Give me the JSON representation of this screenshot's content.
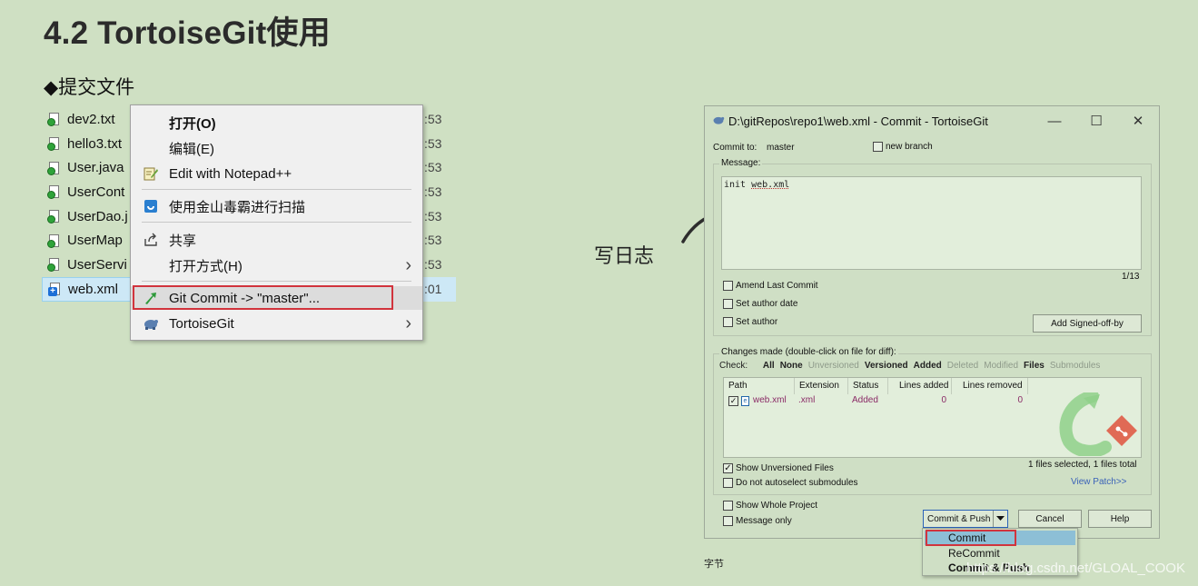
{
  "page": {
    "title": "4.2 TortoiseGit使用",
    "subtitle": "◆提交文件",
    "annotation": "写日志"
  },
  "files": [
    {
      "name": "dev2.txt",
      "time": ":53",
      "status": "ok"
    },
    {
      "name": "hello3.txt",
      "time": ":53",
      "status": "ok"
    },
    {
      "name": "User.java",
      "time": ":53",
      "status": "ok"
    },
    {
      "name": "UserCont",
      "time": ":53",
      "status": "ok"
    },
    {
      "name": "UserDao.j",
      "time": ":53",
      "status": "ok"
    },
    {
      "name": "UserMap",
      "time": ":53",
      "status": "ok"
    },
    {
      "name": "UserServi",
      "time": ":53",
      "status": "ok"
    },
    {
      "name": "web.xml",
      "time": ":01",
      "status": "added"
    }
  ],
  "context_menu": {
    "items": [
      {
        "label": "打开(O)",
        "icon": "",
        "bold": true
      },
      {
        "label": "编辑(E)",
        "icon": ""
      },
      {
        "label": "Edit with Notepad++",
        "icon": "notepad-icon"
      },
      {
        "label": "使用金山毒霸进行扫描",
        "icon": "shield-icon"
      },
      {
        "label": "共享",
        "icon": "share-icon"
      },
      {
        "label": "打开方式(H)",
        "icon": "",
        "submenu": true
      },
      {
        "label": "Git Commit -> \"master\"...",
        "icon": "git-commit-icon"
      },
      {
        "label": "TortoiseGit",
        "icon": "tortoisegit-icon",
        "submenu": true
      }
    ]
  },
  "dialog": {
    "title": "D:\\gitRepos\\repo1\\web.xml - Commit - TortoiseGit",
    "win_controls": {
      "minimize": "—",
      "maximize": "☐",
      "close": "✕"
    },
    "commit_to_label": "Commit to:",
    "branch": "master",
    "new_branch_label": "new branch",
    "message_label": "Message:",
    "message_prefix": "init ",
    "message_file": "web.xml",
    "counter": "1/13",
    "amend_label": "Amend Last Commit",
    "set_author_date_label": "Set author date",
    "set_author_label": "Set author",
    "add_signed_off_label": "Add Signed-off-by",
    "changes_label": "Changes made (double-click on file for diff):",
    "check_label": "Check:",
    "filters": [
      {
        "label": "All",
        "active": true
      },
      {
        "label": "None",
        "active": true
      },
      {
        "label": "Unversioned",
        "active": false
      },
      {
        "label": "Versioned",
        "active": true
      },
      {
        "label": "Added",
        "active": true
      },
      {
        "label": "Deleted",
        "active": false
      },
      {
        "label": "Modified",
        "active": false
      },
      {
        "label": "Files",
        "active": true
      },
      {
        "label": "Submodules",
        "active": false
      }
    ],
    "columns": [
      "Path",
      "Extension",
      "Status",
      "Lines added",
      "Lines removed"
    ],
    "rows": [
      {
        "path": "web.xml",
        "ext": ".xml",
        "status": "Added",
        "added": "0",
        "removed": "0"
      }
    ],
    "show_unversioned_label": "Show Unversioned Files",
    "no_autoselect_label": "Do not autoselect submodules",
    "files_selected": "1 files selected, 1 files total",
    "view_patch": "View Patch>>",
    "show_whole_label": "Show Whole Project",
    "message_only_label": "Message only",
    "commit_push_label": "Commit & Push",
    "cancel_label": "Cancel",
    "help_label": "Help"
  },
  "dropdown": {
    "items": [
      "Commit",
      "ReCommit",
      "Commit & Push"
    ]
  },
  "statusbar": {
    "text": "字节"
  },
  "watermark": "https://blog.csdn.net/GLOAL_COOK",
  "colors": {
    "background": "#cfe0c3",
    "highlight_red": "#d1343d",
    "selection": "#cde8f6"
  }
}
